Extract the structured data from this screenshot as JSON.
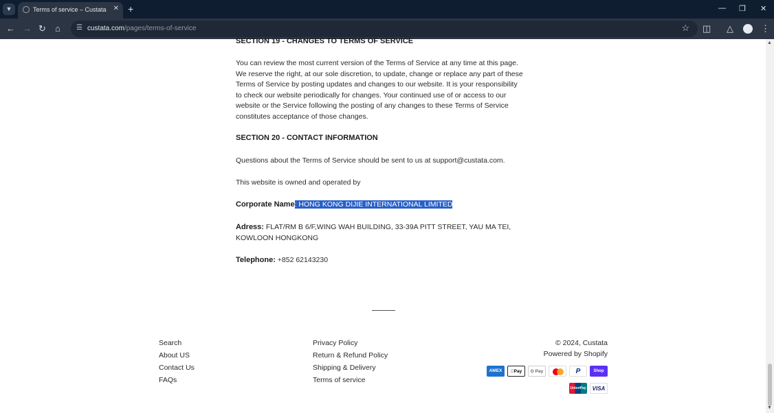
{
  "browser": {
    "tab_title": "Terms of service – Custata",
    "url_host": "custata.com",
    "url_path": "/pages/terms-of-service"
  },
  "content": {
    "section19_heading": "SECTION 19 - CHANGES TO TERMS OF SERVICE",
    "section19_text": "You can review the most current version of the Terms of Service at any time at this page. We reserve the right, at our sole discretion, to update, change or replace any part of these Terms of Service by posting updates and changes to our website. It is your responsibility to check our website periodically for changes. Your continued use of or access to our website or the Service following the posting of any changes to these Terms of Service constitutes acceptance of those changes.",
    "section20_heading": "SECTION 20 - CONTACT INFORMATION",
    "contact_text": "Questions about the Terms of Service should be sent to us at support@custata.com.",
    "owned_text": "This website is owned and operated by",
    "corporate_label": "Corporate Name",
    "corporate_value": ":  HONG KONG DIJIE INTERNATIONAL LIMITED",
    "address_label": "Adress:",
    "address_value": " FLAT/RM B 6/F,WING WAH BUILDING, 33-39A PITT STREET, YAU MA TEI, KOWLOON HONGKONG",
    "telephone_label": "Telephone:",
    "telephone_value": " +852 62143230"
  },
  "footer": {
    "col1": [
      "Search",
      "About US",
      "Contact Us",
      "FAQs"
    ],
    "col2": [
      "Privacy Policy",
      "Return & Refund Policy",
      "Shipping & Delivery",
      "Terms of service"
    ],
    "copyright": "© 2024, Custata",
    "powered": "Powered by Shopify",
    "payments": {
      "amex": "AMEX",
      "apple": "Pay",
      "google": "G Pay",
      "paypal": "P",
      "shop": "Shop Pay",
      "unionpay": "UnionPay",
      "visa": "VISA"
    }
  }
}
